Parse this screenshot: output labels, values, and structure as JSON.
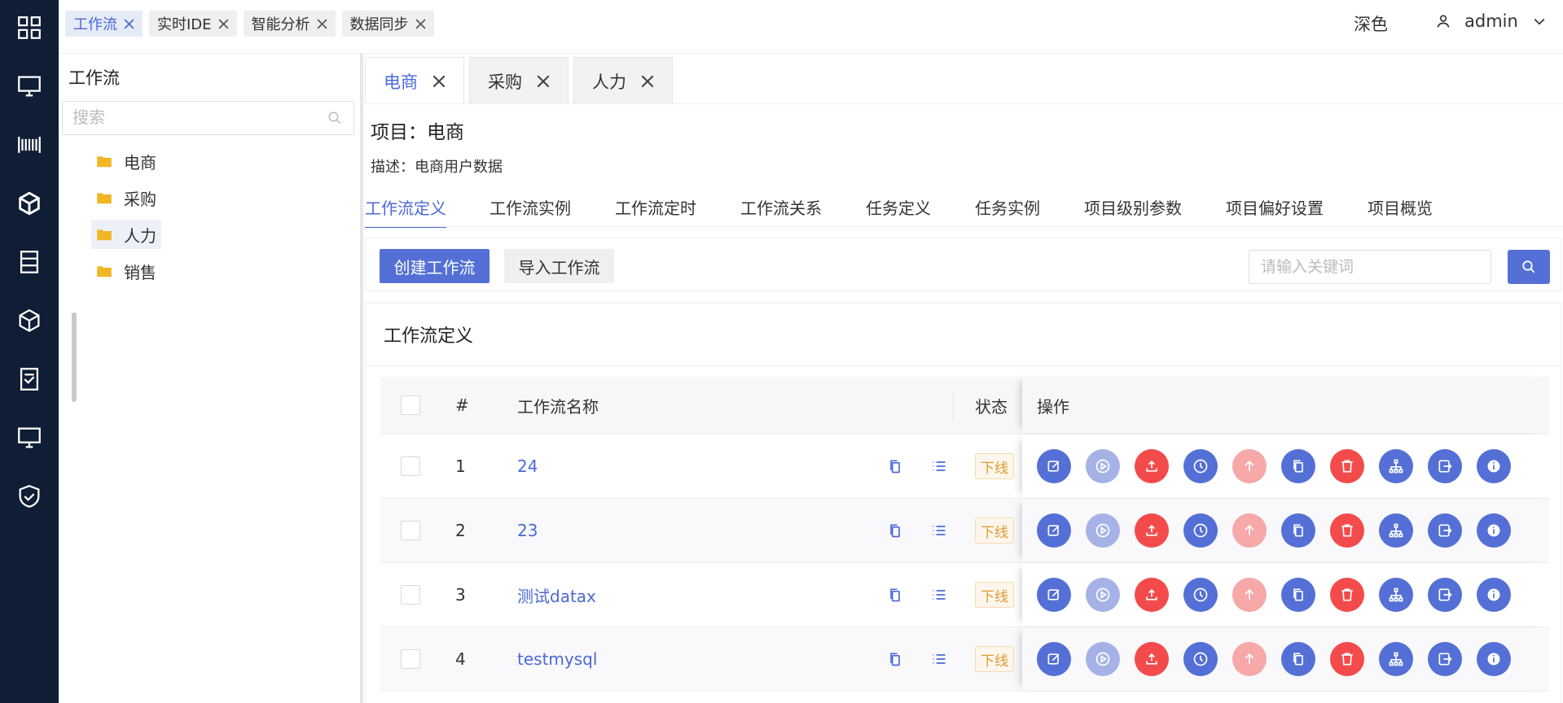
{
  "rail": {
    "icons": [
      "grid-icon",
      "monitor-icon",
      "barcode-icon",
      "cube-icon",
      "server-icon",
      "box-icon",
      "document-icon",
      "display-icon",
      "shield-check-icon"
    ]
  },
  "topbar": {
    "tabs": [
      {
        "label": "工作流",
        "active": true
      },
      {
        "label": "实时IDE",
        "active": false
      },
      {
        "label": "智能分析",
        "active": false
      },
      {
        "label": "数据同步",
        "active": false
      }
    ],
    "theme_label": "深色",
    "user_name": "admin"
  },
  "sidebar": {
    "title": "工作流",
    "search_placeholder": "搜索",
    "items": [
      {
        "label": "电商",
        "selected": false
      },
      {
        "label": "采购",
        "selected": false
      },
      {
        "label": "人力",
        "selected": true
      },
      {
        "label": "销售",
        "selected": false
      }
    ]
  },
  "project_tabs": [
    {
      "label": "电商",
      "active": true
    },
    {
      "label": "采购",
      "active": false
    },
    {
      "label": "人力",
      "active": false
    }
  ],
  "project": {
    "title": "项目：电商",
    "description": "描述：电商用户数据"
  },
  "sub_tabs": [
    {
      "label": "工作流定义",
      "active": true
    },
    {
      "label": "工作流实例",
      "active": false
    },
    {
      "label": "工作流定时",
      "active": false
    },
    {
      "label": "工作流关系",
      "active": false
    },
    {
      "label": "任务定义",
      "active": false
    },
    {
      "label": "任务实例",
      "active": false
    },
    {
      "label": "项目级别参数",
      "active": false
    },
    {
      "label": "项目偏好设置",
      "active": false
    },
    {
      "label": "项目概览",
      "active": false
    }
  ],
  "toolbar": {
    "create_label": "创建工作流",
    "import_label": "导入工作流",
    "keyword_placeholder": "请输入关键词"
  },
  "card": {
    "title": "工作流定义"
  },
  "table": {
    "headers": {
      "index": "#",
      "name": "工作流名称",
      "status": "状态",
      "ops": "操作"
    },
    "rows": [
      {
        "index": "1",
        "name": "24",
        "status": "下线"
      },
      {
        "index": "2",
        "name": "23",
        "status": "下线"
      },
      {
        "index": "3",
        "name": "测试datax",
        "status": "下线"
      },
      {
        "index": "4",
        "name": "testmysql",
        "status": "下线"
      }
    ],
    "operations": [
      {
        "icon": "edit-icon",
        "color": "#5470d6"
      },
      {
        "icon": "play-icon",
        "color": "#a6b2e6"
      },
      {
        "icon": "upload-icon",
        "color": "#f34b4b"
      },
      {
        "icon": "clock-icon",
        "color": "#5470d6"
      },
      {
        "icon": "arrow-up-icon",
        "color": "#f7a8a8"
      },
      {
        "icon": "copy-icon",
        "color": "#5470d6"
      },
      {
        "icon": "delete-icon",
        "color": "#f34b4b"
      },
      {
        "icon": "tree-icon",
        "color": "#5470d6"
      },
      {
        "icon": "export-icon",
        "color": "#5470d6"
      },
      {
        "icon": "info-icon",
        "color": "#5470d6"
      }
    ]
  },
  "colors": {
    "accent": "#5470d6",
    "rail_bg": "#0f1d35",
    "danger": "#f34b4b",
    "warning": "#e09a30"
  }
}
